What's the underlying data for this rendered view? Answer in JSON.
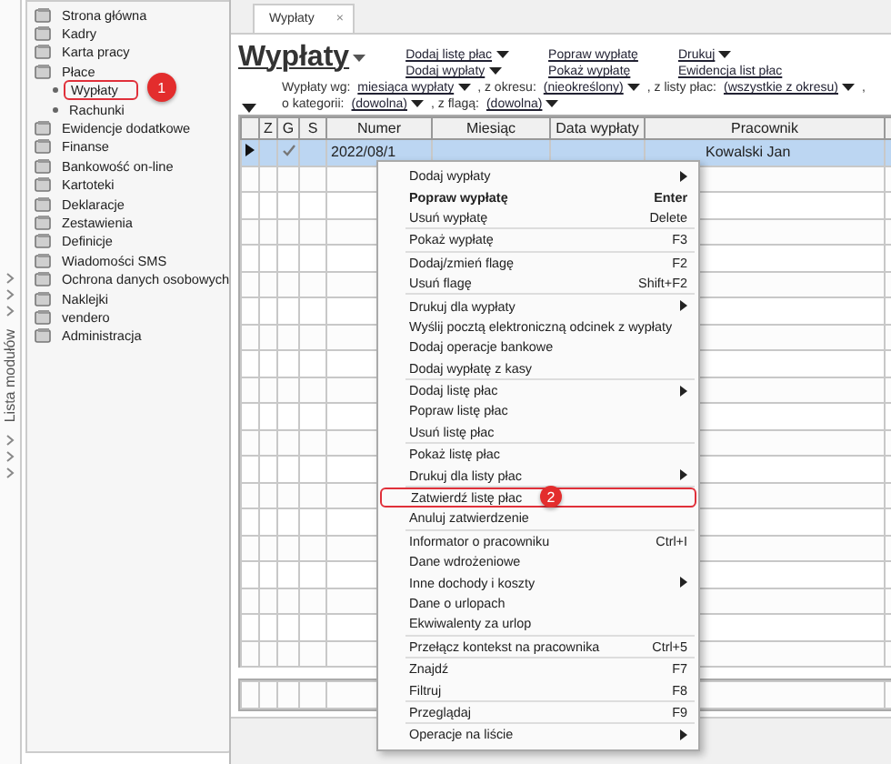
{
  "sidebar": {
    "strip_label": "Lista modułów",
    "items": [
      {
        "label": "Strona główna"
      },
      {
        "label": "Kadry"
      },
      {
        "label": "Karta pracy"
      },
      {
        "label": "Płace",
        "children": [
          {
            "label": "Wypłaty",
            "callout": "1"
          },
          {
            "label": "Rachunki"
          }
        ]
      },
      {
        "label": "Ewidencje dodatkowe"
      },
      {
        "label": "Finanse"
      },
      {
        "label": "Bankowość on-line"
      },
      {
        "label": "Kartoteki"
      },
      {
        "label": "Deklaracje"
      },
      {
        "label": "Zestawienia"
      },
      {
        "label": "Definicje"
      },
      {
        "label": "Wiadomości SMS"
      },
      {
        "label": "Ochrona danych osobowych"
      },
      {
        "label": "Naklejki"
      },
      {
        "label": "vendero"
      },
      {
        "label": "Administracja"
      }
    ]
  },
  "tab": {
    "label": "Wypłaty",
    "close": "×"
  },
  "header": {
    "title": "Wypłaty",
    "links": [
      {
        "label": "Dodaj listę płac",
        "dropdown": true
      },
      {
        "label": "Dodaj wypłaty",
        "dropdown": true
      },
      {
        "label": "Popraw wypłatę",
        "dropdown": false
      },
      {
        "label": "Pokaż wypłatę",
        "dropdown": false
      },
      {
        "label": "Drukuj",
        "dropdown": true
      },
      {
        "label": "Ewidencja list płac",
        "dropdown": false
      }
    ]
  },
  "filters": [
    [
      {
        "kind": "text",
        "label": "Wypłaty wg:"
      },
      {
        "kind": "link",
        "label": "miesiąca wypłaty"
      },
      {
        "kind": "text",
        "label": ", z okresu:"
      },
      {
        "kind": "link",
        "label": "(nieokreślony)"
      },
      {
        "kind": "text",
        "label": ", z listy płac:"
      },
      {
        "kind": "link",
        "label": "(wszystkie z okresu)"
      },
      {
        "kind": "text",
        "label": ","
      }
    ],
    [
      {
        "kind": "text",
        "label": "o kategorii:"
      },
      {
        "kind": "link",
        "label": "(dowolna)"
      },
      {
        "kind": "text",
        "label": ", z flagą:"
      },
      {
        "kind": "link",
        "label": "(dowolna)"
      }
    ]
  ],
  "table": {
    "columns": [
      "Z",
      "G",
      "S",
      "Numer",
      "Miesiąc",
      "Data wypłaty",
      "Pracownik"
    ],
    "rows": [
      {
        "selected": true,
        "current": true,
        "g_checked": true,
        "numer": "2022/08/1",
        "pracownik": "Kowalski Jan"
      }
    ]
  },
  "context_menu": {
    "groups": [
      [
        {
          "label": "Dodaj wypłaty",
          "submenu": true,
          "default": false
        },
        {
          "label": "Popraw wypłatę",
          "shortcut": "Enter",
          "submenu": false,
          "default": true
        },
        {
          "label": "Usuń wypłatę",
          "shortcut": "Delete",
          "submenu": false,
          "default": false
        }
      ],
      [
        {
          "label": "Pokaż wypłatę",
          "shortcut": "F3",
          "submenu": false,
          "default": false
        }
      ],
      [
        {
          "label": "Dodaj/zmień flagę",
          "shortcut": "F2",
          "submenu": false,
          "default": false
        },
        {
          "label": "Usuń flagę",
          "shortcut": "Shift+F2",
          "submenu": false,
          "default": false
        }
      ],
      [
        {
          "label": "Drukuj dla wypłaty",
          "submenu": true,
          "default": false
        },
        {
          "label": "Wyślij pocztą elektroniczną odcinek z wypłaty",
          "submenu": false,
          "default": false
        },
        {
          "label": "Dodaj operacje bankowe",
          "submenu": false,
          "default": false
        },
        {
          "label": "Dodaj wypłatę z kasy",
          "submenu": false,
          "default": false
        }
      ],
      [
        {
          "label": "Dodaj listę płac",
          "submenu": true,
          "default": false
        },
        {
          "label": "Popraw listę płac",
          "submenu": false,
          "default": false
        },
        {
          "label": "Usuń listę płac",
          "submenu": false,
          "default": false
        }
      ],
      [
        {
          "label": "Pokaż listę płac",
          "submenu": false,
          "default": false
        },
        {
          "label": "Drukuj dla listy płac",
          "submenu": true,
          "default": false
        }
      ],
      [
        {
          "label": "Zatwierdź listę płac",
          "submenu": false,
          "default": false,
          "callout": "2"
        },
        {
          "label": "Anuluj zatwierdzenie",
          "submenu": false,
          "default": false
        }
      ],
      [
        {
          "label": "Informator o pracowniku",
          "shortcut": "Ctrl+I",
          "submenu": false,
          "default": false
        },
        {
          "label": "Dane wdrożeniowe",
          "submenu": false,
          "default": false
        },
        {
          "label": "Inne dochody i koszty",
          "submenu": true,
          "default": false
        },
        {
          "label": "Dane o urlopach",
          "submenu": false,
          "default": false
        },
        {
          "label": "Ekwiwalenty za urlop",
          "submenu": false,
          "default": false
        }
      ],
      [
        {
          "label": "Przełącz kontekst na pracownika",
          "shortcut": "Ctrl+5",
          "submenu": false,
          "default": false
        }
      ],
      [
        {
          "label": "Znajdź",
          "shortcut": "F7",
          "submenu": false,
          "default": false
        },
        {
          "label": "Filtruj",
          "shortcut": "F8",
          "submenu": false,
          "default": false
        }
      ],
      [
        {
          "label": "Przeglądaj",
          "shortcut": "F9",
          "submenu": false,
          "default": false
        }
      ],
      [
        {
          "label": "Operacje na liście",
          "submenu": true,
          "default": false
        }
      ]
    ]
  }
}
